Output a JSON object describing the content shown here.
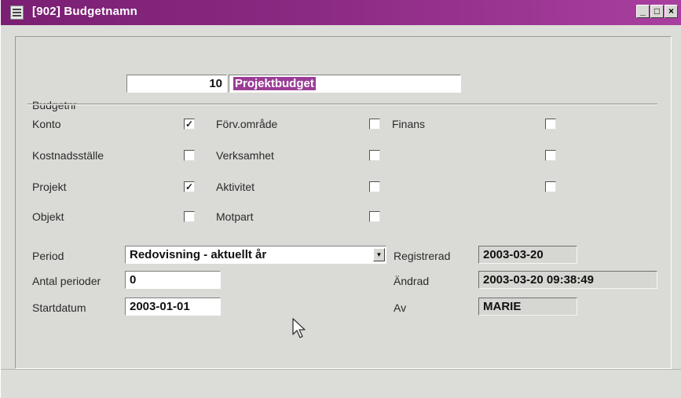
{
  "window": {
    "title": "[902] Budgetnamn",
    "min_label": "_",
    "max_label": "□",
    "close_label": "×"
  },
  "form": {
    "budgetnr_label": "Budgetnr",
    "budgetnr_value": "10",
    "budget_name_value": "Projektbudget",
    "checks": {
      "konto": {
        "label": "Konto",
        "checked": true,
        "mark": "✓"
      },
      "kostnadsstalle": {
        "label": "Kostnadsställe",
        "checked": false,
        "mark": ""
      },
      "projekt": {
        "label": "Projekt",
        "checked": true,
        "mark": "✓"
      },
      "objekt": {
        "label": "Objekt",
        "checked": false,
        "mark": ""
      },
      "forv_omrade": {
        "label": "Förv.område",
        "checked": false,
        "mark": ""
      },
      "verksamhet": {
        "label": "Verksamhet",
        "checked": false,
        "mark": ""
      },
      "aktivitet": {
        "label": "Aktivitet",
        "checked": false,
        "mark": ""
      },
      "motpart": {
        "label": "Motpart",
        "checked": false,
        "mark": ""
      },
      "finans": {
        "label": "Finans",
        "checked": false,
        "mark": ""
      },
      "extra2": {
        "label": "",
        "checked": false,
        "mark": ""
      },
      "extra3": {
        "label": "",
        "checked": false,
        "mark": ""
      }
    },
    "period_label": "Period",
    "period_value": "Redovisning - aktuellt år",
    "antal_perioder_label": "Antal perioder",
    "antal_perioder_value": "0",
    "startdatum_label": "Startdatum",
    "startdatum_value": "2003-01-01",
    "registrerad_label": "Registrerad",
    "registrerad_value": "2003-03-20",
    "andrad_label": "Ändrad",
    "andrad_value": "2003-03-20 09:38:49",
    "av_label": "Av",
    "av_value": "MARIE"
  },
  "colors": {
    "titlebar": "#7a1f73",
    "highlight": "#9b3c96"
  },
  "icons": {
    "window_icon": "document-icon",
    "dropdown": "chevron-down-icon",
    "cursor": "mouse-pointer-icon"
  }
}
